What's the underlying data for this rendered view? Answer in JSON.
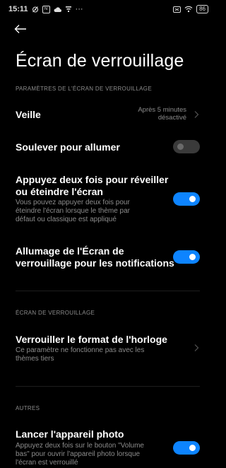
{
  "status_bar": {
    "time": "15:11",
    "more": "···",
    "battery": "86"
  },
  "page": {
    "title": "Écran de verrouillage"
  },
  "sections": {
    "lockscreen_params": "PARAMÈTRES DE L'ÉCRAN DE VERROUILLAGE",
    "lockscreen": "ÉCRAN DE VERROUILLAGE",
    "others": "AUTRES"
  },
  "rows": {
    "sleep": {
      "title": "Veille",
      "value_line1": "Après 5 minutes",
      "value_line2": "désactivé"
    },
    "raise_to_wake": {
      "title": "Soulever pour allumer",
      "enabled": false
    },
    "double_tap": {
      "title_line1": "Appuyez deux fois pour réveiller",
      "title_line2": "ou éteindre l'écran",
      "sub_line1": "Vous pouvez appuyer deux fois pour",
      "sub_line2": "éteindre l'écran lorsque le thème par",
      "sub_line3": "défaut ou classique est appliqué",
      "enabled": true
    },
    "notifications_wake": {
      "title_line1": "Allumage de l'Écran de",
      "title_line2": "verrouillage pour les notifications",
      "enabled": true
    },
    "clock_format": {
      "title": "Verrouiller le format de l'horloge",
      "sub_line1": "Ce paramètre ne fonctionne pas avec les",
      "sub_line2": "thèmes tiers"
    },
    "camera": {
      "title": "Lancer l'appareil photo",
      "sub_line1": "Appuyez deux fois sur le bouton \"Volume",
      "sub_line2": "bas\" pour ouvrir l'appareil photo lorsque",
      "sub_line3": "l'écran est verrouillé",
      "enabled": true
    }
  },
  "colors": {
    "background": "#000000",
    "accent": "#0d84ff",
    "secondary_text": "#8c8c8c"
  },
  "icons": [
    "alarm-icon",
    "nfc-icon",
    "cloud-icon",
    "signal-icon",
    "sim-icon",
    "wifi-icon",
    "battery-icon",
    "back-arrow-icon",
    "chevron-right-icon"
  ]
}
